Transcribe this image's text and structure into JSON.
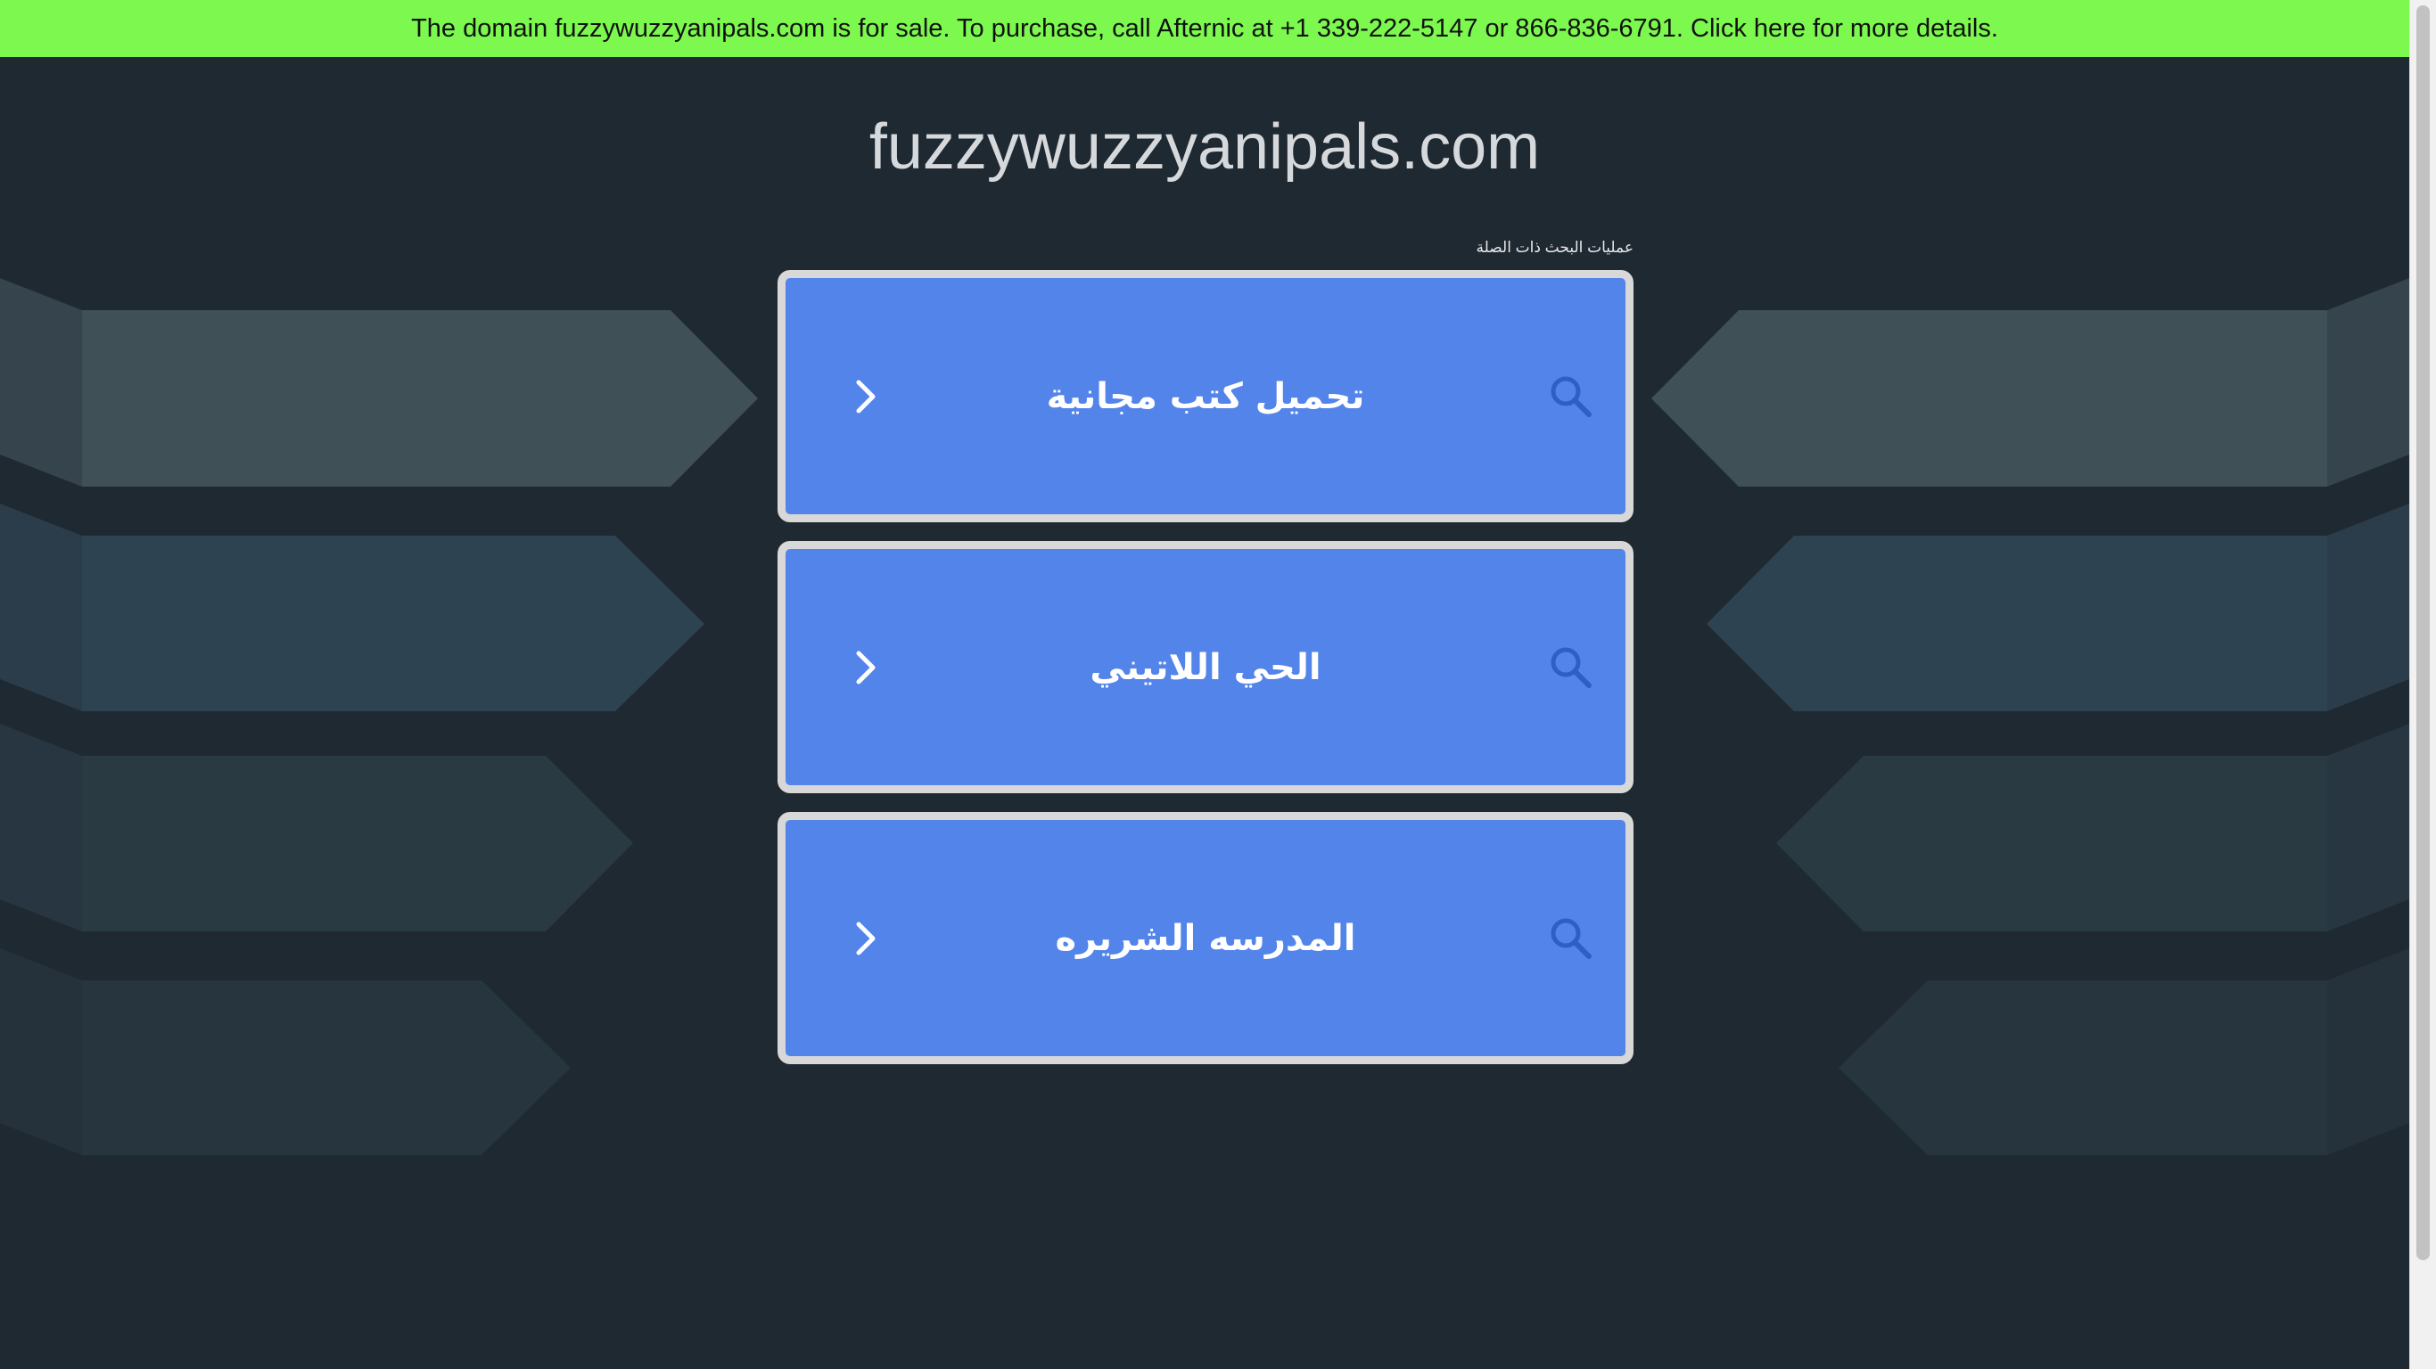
{
  "banner": {
    "text": "The domain fuzzywuzzyanipals.com is for sale. To purchase, call Afternic at +1 339-222-5147 or 866-836-6791. Click here for more details."
  },
  "site": {
    "title": "fuzzywuzzyanipals.com"
  },
  "related": {
    "label": "عمليات البحث ذات الصلة",
    "items": [
      {
        "label": "تحميل كتب مجانية"
      },
      {
        "label": "الحي اللاتيني"
      },
      {
        "label": "المدرسه الشريره"
      }
    ]
  },
  "colors": {
    "banner": "#7cf84f",
    "page_background": "#1f2932",
    "card_background": "#5384ea",
    "card_border": "#d8d8d8"
  },
  "icons": {
    "arrow": "chevron-right-icon",
    "search": "search-icon"
  }
}
